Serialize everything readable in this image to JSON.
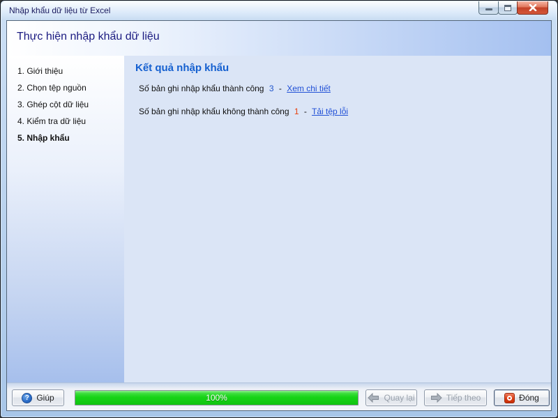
{
  "window": {
    "title": "Nhập khẩu dữ liệu từ Excel",
    "controls": [
      {
        "name": "minimize"
      },
      {
        "name": "maximize"
      },
      {
        "name": "close"
      }
    ]
  },
  "header": {
    "title": "Thực hiện nhập khẩu dữ liệu"
  },
  "sidebar": {
    "items": [
      {
        "label": "1. Giới thiệu",
        "active": false
      },
      {
        "label": "2. Chọn tệp nguồn",
        "active": false
      },
      {
        "label": "3. Ghép cột dữ liệu",
        "active": false
      },
      {
        "label": "4. Kiểm tra dữ liệu",
        "active": false
      },
      {
        "label": "5. Nhập khẩu",
        "active": true
      }
    ]
  },
  "content": {
    "heading": "Kết quả nhập khẩu",
    "success": {
      "label": "Số bản ghi nhập khẩu thành công",
      "count": "3",
      "separator": "-",
      "link": "Xem chi tiết"
    },
    "failure": {
      "label": "Số bản ghi nhập khẩu không thành công",
      "count": "1",
      "separator": "-",
      "link": "Tải tệp lỗi"
    }
  },
  "footer": {
    "help": {
      "label": "Giúp"
    },
    "progress": {
      "text": "100%",
      "percent": 100
    },
    "back": {
      "label": "Quay lại",
      "disabled": true
    },
    "next": {
      "label": "Tiếp theo",
      "disabled": true
    },
    "close": {
      "label": "Đóng",
      "disabled": false
    }
  },
  "colors": {
    "header_text": "#1a1a80",
    "heading_blue": "#1560d0",
    "link_blue": "#1f4fd6",
    "success_count_blue": "#2055cc",
    "error_count_red": "#e8400c",
    "progress_green": "#17d417",
    "close_button_red": "#c44228"
  }
}
